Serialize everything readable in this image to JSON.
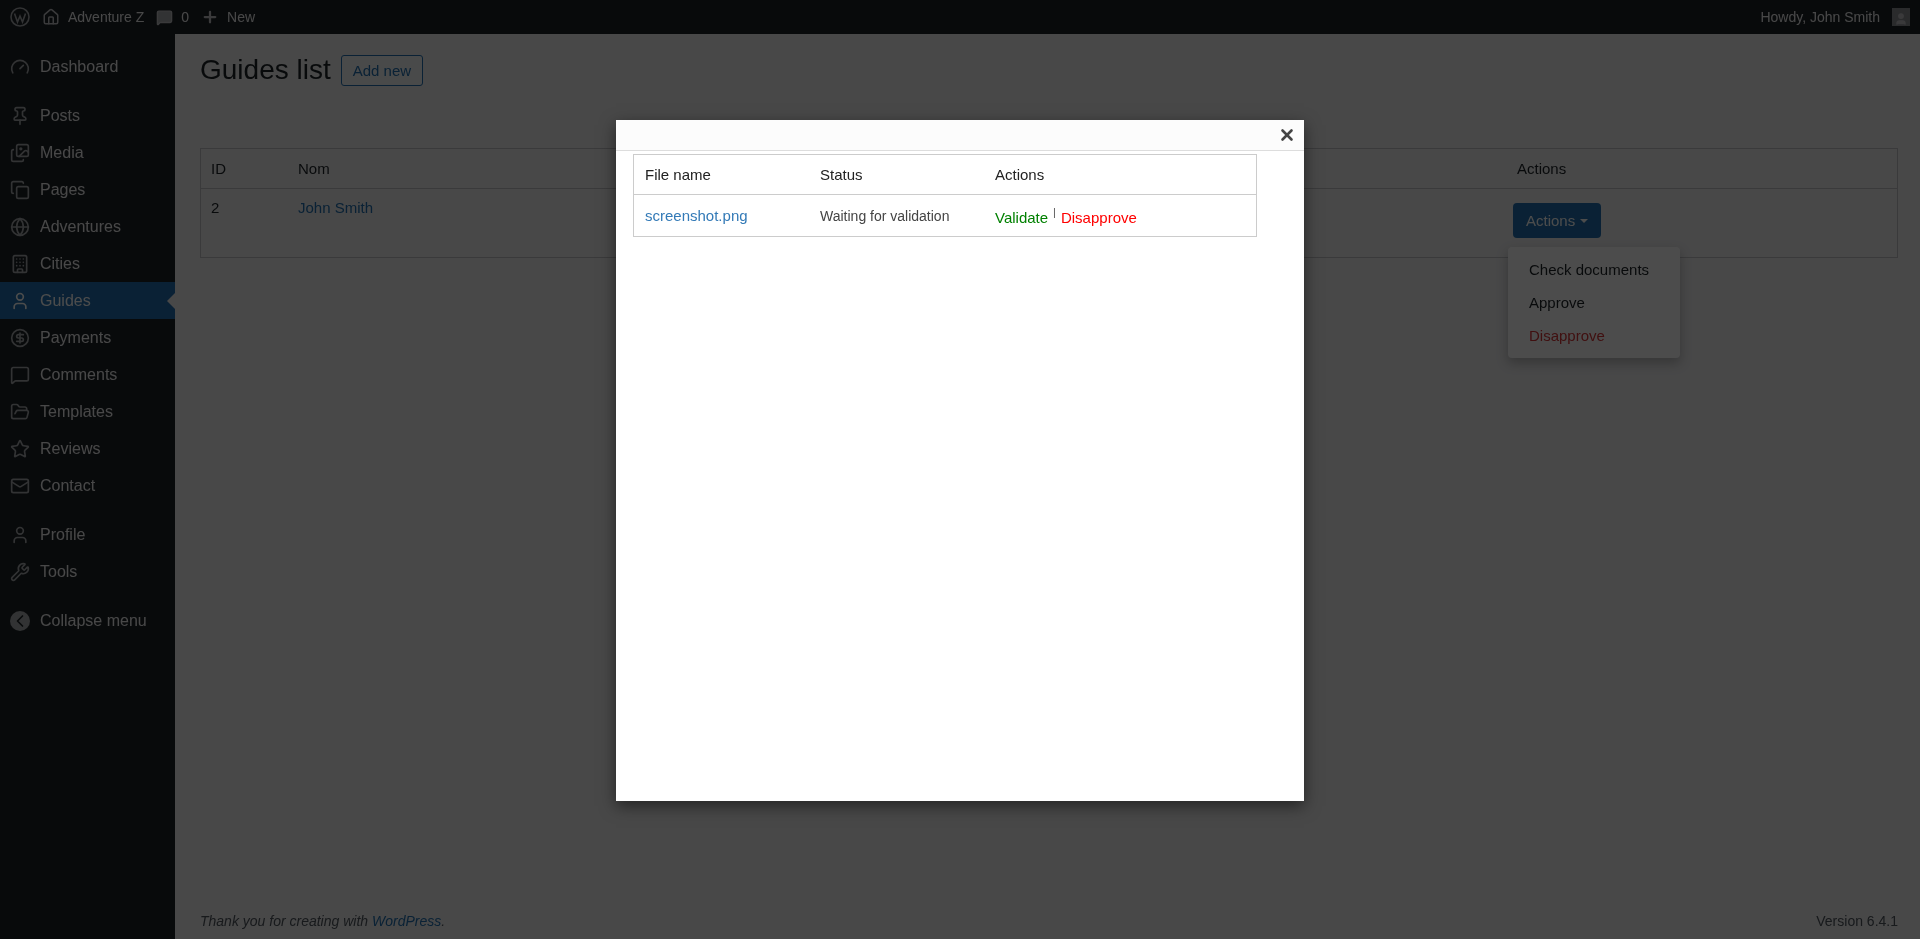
{
  "admin_bar": {
    "site_name": "Adventure Z",
    "comments_count": "0",
    "new_label": "New",
    "greeting": "Howdy, John Smith"
  },
  "sidebar": {
    "groups": [
      [
        {
          "label": "Dashboard",
          "selected": false
        }
      ],
      [
        {
          "label": "Posts",
          "selected": false
        },
        {
          "label": "Media",
          "selected": false
        },
        {
          "label": "Pages",
          "selected": false
        },
        {
          "label": "Adventures",
          "selected": false
        },
        {
          "label": "Cities",
          "selected": false
        },
        {
          "label": "Guides",
          "selected": true
        },
        {
          "label": "Payments",
          "selected": false
        },
        {
          "label": "Comments",
          "selected": false
        },
        {
          "label": "Templates",
          "selected": false
        },
        {
          "label": "Reviews",
          "selected": false
        },
        {
          "label": "Contact",
          "selected": false
        }
      ],
      [
        {
          "label": "Profile",
          "selected": false
        },
        {
          "label": "Tools",
          "selected": false
        }
      ]
    ],
    "collapse_label": "Collapse menu"
  },
  "page": {
    "title": "Guides list",
    "add_button": "Add new",
    "table": {
      "columns": [
        "ID",
        "Nom",
        "Actions"
      ],
      "rows": [
        {
          "id": "2",
          "name": "John Smith",
          "actions_button": "Actions"
        }
      ]
    },
    "dropdown": {
      "items": [
        {
          "label": "Check documents",
          "kind": "normal"
        },
        {
          "label": "Approve",
          "kind": "normal"
        },
        {
          "label": "Disapprove",
          "kind": "danger"
        }
      ]
    }
  },
  "footer": {
    "thanks_prefix": "Thank you for creating with ",
    "link": "WordPress",
    "thanks_suffix": ".",
    "version": "Version 6.4.1"
  },
  "modal": {
    "columns": [
      "File name",
      "Status",
      "Actions"
    ],
    "rows": [
      {
        "file": "screenshot.png",
        "status": "Waiting for validation",
        "separator": "|",
        "actions": [
          {
            "label": "Validate",
            "kind": "validate"
          },
          {
            "label": "Disapprove",
            "kind": "disapprove"
          }
        ]
      }
    ]
  }
}
